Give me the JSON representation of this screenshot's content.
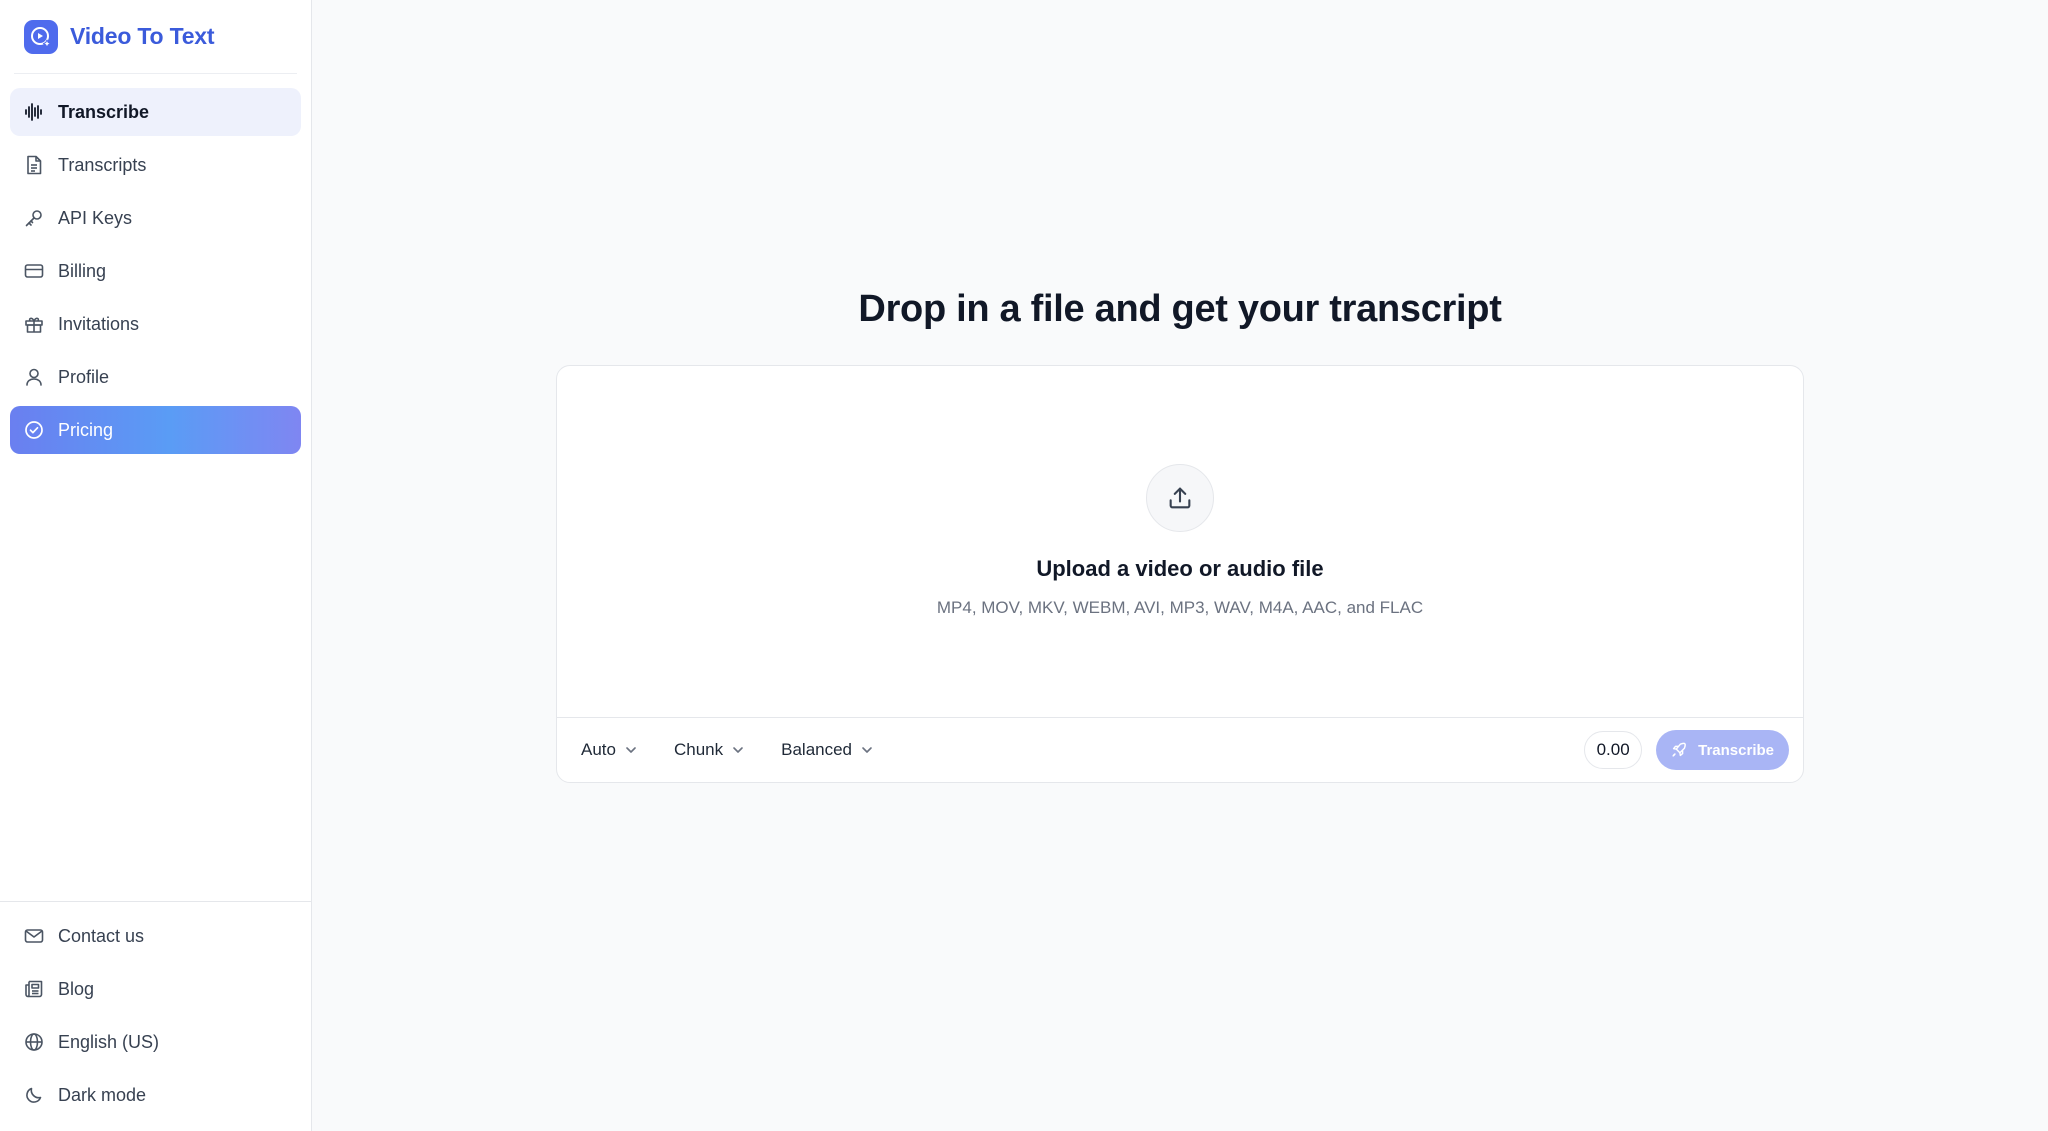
{
  "brand": {
    "name": "Video To Text"
  },
  "nav": {
    "items": [
      {
        "label": "Transcribe",
        "icon": "audio-wave-icon"
      },
      {
        "label": "Transcripts",
        "icon": "document-icon"
      },
      {
        "label": "API Keys",
        "icon": "key-icon"
      },
      {
        "label": "Billing",
        "icon": "credit-card-icon"
      },
      {
        "label": "Invitations",
        "icon": "gift-icon"
      },
      {
        "label": "Profile",
        "icon": "user-icon"
      },
      {
        "label": "Pricing",
        "icon": "check-circle-icon"
      }
    ],
    "active": "Transcribe",
    "highlight": "Pricing"
  },
  "bottom_nav": {
    "items": [
      {
        "label": "Contact us",
        "icon": "mail-icon"
      },
      {
        "label": "Blog",
        "icon": "newspaper-icon"
      },
      {
        "label": "English (US)",
        "icon": "globe-icon"
      },
      {
        "label": "Dark mode",
        "icon": "moon-icon"
      }
    ]
  },
  "main": {
    "headline": "Drop in a file and get your transcript",
    "upload": {
      "title": "Upload a video or audio file",
      "formats": "MP4, MOV, MKV, WEBM, AVI, MP3, WAV, M4A, AAC, and FLAC",
      "icon": "upload-icon"
    },
    "toolbar": {
      "language": "Auto",
      "mode": "Chunk",
      "quality": "Balanced",
      "cost": "0.00",
      "transcribe_label": "Transcribe",
      "transcribe_icon": "rocket-icon"
    }
  },
  "colors": {
    "brand": "#3b5bdb",
    "active_bg": "#eef1fc",
    "pricing_gradient_start": "#6a7ff0",
    "pricing_gradient_end": "#7f86f2",
    "transcribe_button": "#a9b5f5",
    "background": "#f9fafb"
  }
}
